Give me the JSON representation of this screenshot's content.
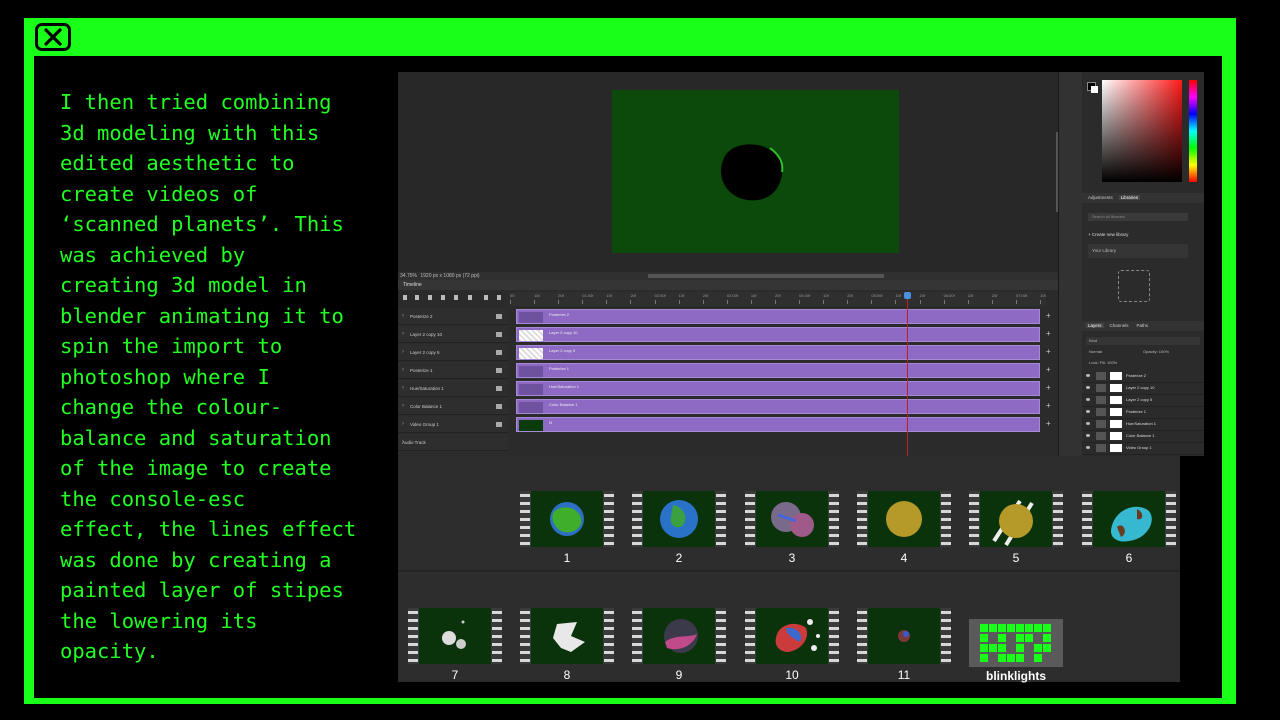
{
  "slide": {
    "caption": "I then tried combining\n3d modeling with this\nedited aesthetic to\ncreate videos of\n‘scanned planets’. This\nwas achieved by\ncreating 3d model in\nblender animating it to\nspin the import to\nphotoshop where I\nchange the colour-\nbalance and saturation\nof the image to create\nthe console-esc\neffect, the lines effect\nwas done by creating a\npainted layer of stipes\nthe lowering its\nopacity.",
    "frame_color": "#1aff1a",
    "text_color": "#22ff22"
  },
  "photoshop": {
    "status": "34.75%",
    "doc_info": "1920 px x 1080 px (72 ppi)",
    "timeline_title": "Timeline",
    "ruler_ticks": [
      "00",
      "10f",
      "20f",
      "01:00f",
      "10f",
      "20f",
      "02:00f",
      "10f",
      "20f",
      "03:00f",
      "10f",
      "20f",
      "04:00f",
      "10f",
      "20f",
      "05:00f",
      "10f",
      "20f",
      "06:00f",
      "10f",
      "20f",
      "07:00f",
      "10f"
    ],
    "tracks": [
      {
        "label": "Posterize 2",
        "clip": "Posterize 2"
      },
      {
        "label": "Layer 2 copy 10",
        "clip": "Layer 2 copy 10"
      },
      {
        "label": "Layer 2 copy 5",
        "clip": "Layer 2 copy 5"
      },
      {
        "label": "Posterize 1",
        "clip": "Posterize 1"
      },
      {
        "label": "Hue/Saturation 1",
        "clip": "Hue/Saturation 1"
      },
      {
        "label": "Color Balance 1",
        "clip": "Color Balance 1"
      },
      {
        "label": "Video Group 1",
        "clip": "f4"
      }
    ],
    "audio_label": "Audio Track",
    "panel_tabs_1": [
      "Adjustments",
      "Libraries"
    ],
    "lib_search": "Search all libraries",
    "lib_create": "+ Create new library",
    "lib_yours": "Your Library",
    "panel_tabs_2": [
      "Layers",
      "Channels",
      "Paths"
    ],
    "layers_kind": "Kind",
    "blend_mode": "Normal",
    "opacity": "Opacity: 100%",
    "lock_fill": "Lock:          Fill: 100%",
    "layers": [
      "Posterize 2",
      "Layer 2 copy 10",
      "Layer 2 copy 5",
      "Posterize 1",
      "Hue/Saturation 1",
      "Color Balance 1",
      "Video Group 1"
    ]
  },
  "gallery": {
    "items": [
      {
        "label": "1",
        "icon": "green-blue-planet"
      },
      {
        "label": "2",
        "icon": "earth-planet"
      },
      {
        "label": "3",
        "icon": "double-planet"
      },
      {
        "label": "4",
        "icon": "yellow-planet"
      },
      {
        "label": "5",
        "icon": "yellow-planet-rings"
      },
      {
        "label": "6",
        "icon": "cyan-brown-planet"
      },
      {
        "label": "7",
        "icon": "small-moons"
      },
      {
        "label": "8",
        "icon": "white-debris"
      },
      {
        "label": "9",
        "icon": "purple-planet"
      },
      {
        "label": "10",
        "icon": "red-blue-shattered"
      },
      {
        "label": "11",
        "icon": "tiny-planet"
      }
    ],
    "extra_label": "blinklights"
  }
}
